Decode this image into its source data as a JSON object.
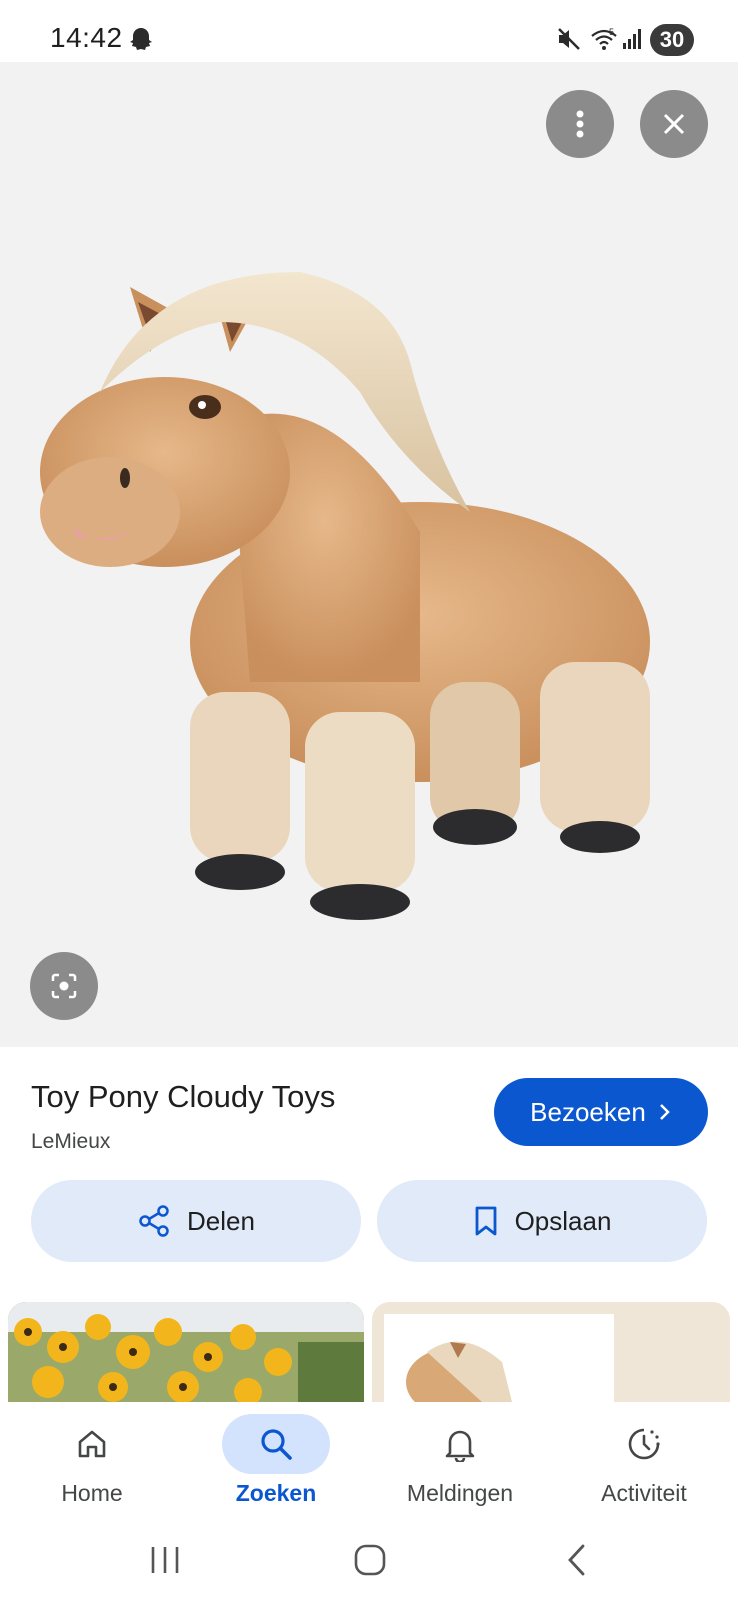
{
  "status_bar": {
    "time": "14:42",
    "battery": "30",
    "network_badge": "5",
    "icons": [
      "ghost-icon",
      "mute-icon",
      "wifi-icon",
      "signal-icon"
    ]
  },
  "image_viewer": {
    "image_description": "plush toy pony",
    "icons": [
      "more-vert-icon",
      "close-icon",
      "lens-icon"
    ]
  },
  "product": {
    "title": "Toy Pony Cloudy Toys",
    "source": "LeMieux",
    "visit_label": "Bezoeken",
    "share_label": "Delen",
    "save_label": "Opslaan"
  },
  "bottom_nav": {
    "items": [
      {
        "label": "Home",
        "icon": "home-icon",
        "active": false
      },
      {
        "label": "Zoeken",
        "icon": "search-icon",
        "active": true
      },
      {
        "label": "Meldingen",
        "icon": "bell-icon",
        "active": false
      },
      {
        "label": "Activiteit",
        "icon": "activity-icon",
        "active": false
      }
    ]
  },
  "system_nav": [
    "recents-button",
    "home-button",
    "back-button"
  ],
  "colors": {
    "accent": "#0b57d0",
    "pill_bg": "#e1eaf9",
    "nav_active_bg": "#d3e3fd",
    "image_bg": "#f2f2f2"
  }
}
